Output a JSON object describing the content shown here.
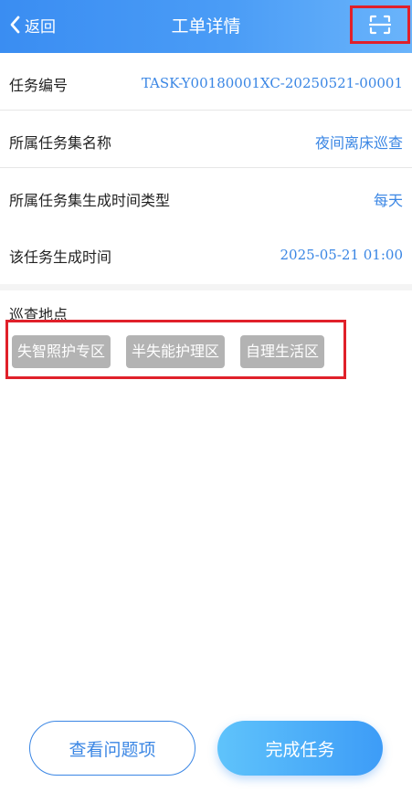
{
  "header": {
    "back_label": "返回",
    "title": "工单详情",
    "scan_icon": "scan-icon",
    "back_icon": "chevron-left-icon"
  },
  "details": [
    {
      "label": "任务编号",
      "value": "TASK-Y00180001XC-20250521-00001"
    },
    {
      "label": "所属任务集名称",
      "value": "夜间离床巡查"
    },
    {
      "label": "所属任务集生成时间类型",
      "value": "每天"
    },
    {
      "label": "该任务生成时间",
      "value": "2025-05-21 01:00"
    }
  ],
  "locations": {
    "title": "巡查地点",
    "tags": [
      "失智照护专区",
      "半失能护理区",
      "自理生活区"
    ]
  },
  "actions": {
    "view_issues": "查看问题项",
    "complete_task": "完成任务"
  },
  "colors": {
    "header_start": "#3a8df2",
    "accent": "#3a86e4",
    "tag_bg": "#b3b3b3",
    "highlight_border": "#e0202a"
  }
}
